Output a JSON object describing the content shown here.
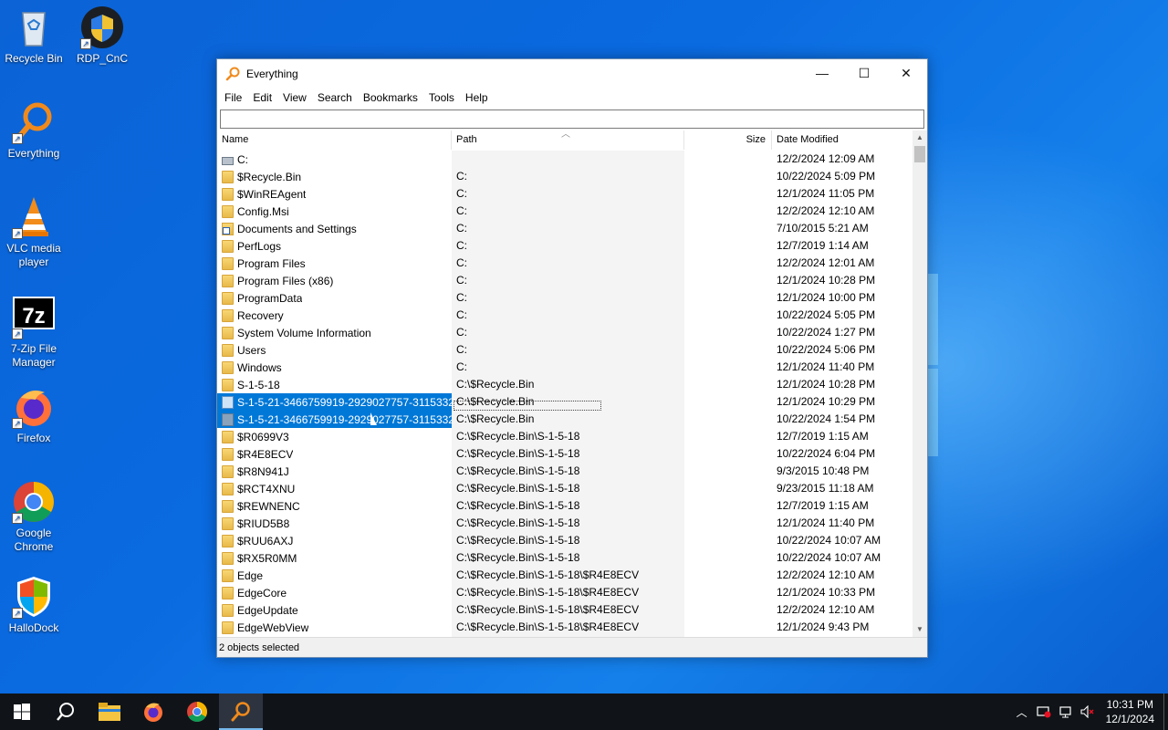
{
  "desktop_icons": [
    {
      "label": "Recycle Bin",
      "icon": "recycle-bin-icon"
    },
    {
      "label": "RDP_CnC",
      "icon": "rdp-shortcut-icon"
    },
    {
      "label": "Everything",
      "icon": "everything-icon"
    },
    {
      "label": "VLC media player",
      "icon": "vlc-icon"
    },
    {
      "label": "7-Zip File Manager",
      "icon": "7zip-icon"
    },
    {
      "label": "Firefox",
      "icon": "firefox-icon"
    },
    {
      "label": "Google Chrome",
      "icon": "chrome-icon"
    },
    {
      "label": "HalloDock",
      "icon": "hallodock-icon"
    }
  ],
  "window": {
    "title": "Everything",
    "controls": {
      "minimize": "—",
      "maximize": "☐",
      "close": "✕"
    }
  },
  "menu": [
    "File",
    "Edit",
    "View",
    "Search",
    "Bookmarks",
    "Tools",
    "Help"
  ],
  "search": {
    "value": "",
    "placeholder": ""
  },
  "columns": {
    "name": "Name",
    "path": "Path",
    "size": "Size",
    "date": "Date Modified"
  },
  "rows": [
    {
      "icon": "drive",
      "name": "C:",
      "path": "",
      "date": "12/2/2024 12:09 AM",
      "selected": false
    },
    {
      "icon": "folder",
      "name": "$Recycle.Bin",
      "path": "C:",
      "date": "10/22/2024 5:09 PM",
      "selected": false
    },
    {
      "icon": "folder",
      "name": "$WinREAgent",
      "path": "C:",
      "date": "12/1/2024 11:05 PM",
      "selected": false
    },
    {
      "icon": "folder",
      "name": "Config.Msi",
      "path": "C:",
      "date": "12/2/2024 12:10 AM",
      "selected": false
    },
    {
      "icon": "link",
      "name": "Documents and Settings",
      "path": "C:",
      "date": "7/10/2015 5:21 AM",
      "selected": false
    },
    {
      "icon": "folder",
      "name": "PerfLogs",
      "path": "C:",
      "date": "12/7/2019 1:14 AM",
      "selected": false
    },
    {
      "icon": "folder",
      "name": "Program Files",
      "path": "C:",
      "date": "12/2/2024 12:01 AM",
      "selected": false
    },
    {
      "icon": "folder",
      "name": "Program Files (x86)",
      "path": "C:",
      "date": "12/1/2024 10:28 PM",
      "selected": false
    },
    {
      "icon": "folder",
      "name": "ProgramData",
      "path": "C:",
      "date": "12/1/2024 10:00 PM",
      "selected": false
    },
    {
      "icon": "folder",
      "name": "Recovery",
      "path": "C:",
      "date": "10/22/2024 5:05 PM",
      "selected": false
    },
    {
      "icon": "folder",
      "name": "System Volume Information",
      "path": "C:",
      "date": "10/22/2024 1:27 PM",
      "selected": false
    },
    {
      "icon": "folder",
      "name": "Users",
      "path": "C:",
      "date": "10/22/2024 5:06 PM",
      "selected": false
    },
    {
      "icon": "folder",
      "name": "Windows",
      "path": "C:",
      "date": "12/1/2024 11:40 PM",
      "selected": false
    },
    {
      "icon": "folder",
      "name": "S-1-5-18",
      "path": "C:\\$Recycle.Bin",
      "date": "12/1/2024 10:28 PM",
      "selected": false
    },
    {
      "icon": "recycle",
      "name": "S-1-5-21-3466759919-2929027757-3115332...",
      "path": "C:\\$Recycle.Bin",
      "date": "12/1/2024 10:29 PM",
      "selected": true
    },
    {
      "icon": "recycle2",
      "name": "S-1-5-21-3466759919-2929027757-3115332...",
      "path": "C:\\$Recycle.Bin",
      "date": "10/22/2024 1:54 PM",
      "selected": true
    },
    {
      "icon": "folder",
      "name": "$R0699V3",
      "path": "C:\\$Recycle.Bin\\S-1-5-18",
      "date": "12/7/2019 1:15 AM",
      "selected": false
    },
    {
      "icon": "folder",
      "name": "$R4E8ECV",
      "path": "C:\\$Recycle.Bin\\S-1-5-18",
      "date": "10/22/2024 6:04 PM",
      "selected": false
    },
    {
      "icon": "folder",
      "name": "$R8N941J",
      "path": "C:\\$Recycle.Bin\\S-1-5-18",
      "date": "9/3/2015 10:48 PM",
      "selected": false
    },
    {
      "icon": "folder",
      "name": "$RCT4XNU",
      "path": "C:\\$Recycle.Bin\\S-1-5-18",
      "date": "9/23/2015 11:18 AM",
      "selected": false
    },
    {
      "icon": "folder",
      "name": "$REWNENC",
      "path": "C:\\$Recycle.Bin\\S-1-5-18",
      "date": "12/7/2019 1:15 AM",
      "selected": false
    },
    {
      "icon": "folder",
      "name": "$RIUD5B8",
      "path": "C:\\$Recycle.Bin\\S-1-5-18",
      "date": "12/1/2024 11:40 PM",
      "selected": false
    },
    {
      "icon": "folder",
      "name": "$RUU6AXJ",
      "path": "C:\\$Recycle.Bin\\S-1-5-18",
      "date": "10/22/2024 10:07 AM",
      "selected": false
    },
    {
      "icon": "folder",
      "name": "$RX5R0MM",
      "path": "C:\\$Recycle.Bin\\S-1-5-18",
      "date": "10/22/2024 10:07 AM",
      "selected": false
    },
    {
      "icon": "folder",
      "name": "Edge",
      "path": "C:\\$Recycle.Bin\\S-1-5-18\\$R4E8ECV",
      "date": "12/2/2024 12:10 AM",
      "selected": false
    },
    {
      "icon": "folder",
      "name": "EdgeCore",
      "path": "C:\\$Recycle.Bin\\S-1-5-18\\$R4E8ECV",
      "date": "12/1/2024 10:33 PM",
      "selected": false
    },
    {
      "icon": "folder",
      "name": "EdgeUpdate",
      "path": "C:\\$Recycle.Bin\\S-1-5-18\\$R4E8ECV",
      "date": "12/2/2024 12:10 AM",
      "selected": false
    },
    {
      "icon": "folder",
      "name": "EdgeWebView",
      "path": "C:\\$Recycle.Bin\\S-1-5-18\\$R4E8ECV",
      "date": "12/1/2024 9:43 PM",
      "selected": false
    }
  ],
  "status": "2 objects selected",
  "taskbar": {
    "buttons": [
      "start-icon",
      "search-icon",
      "file-explorer-icon",
      "firefox-icon",
      "chrome-icon",
      "everything-icon"
    ],
    "active": "everything-icon"
  },
  "clock": {
    "time": "10:31 PM",
    "date": "12/1/2024"
  },
  "colors": {
    "selection": "#0078d7",
    "desktop": "#0a5fd0",
    "taskbar": "#101418"
  }
}
